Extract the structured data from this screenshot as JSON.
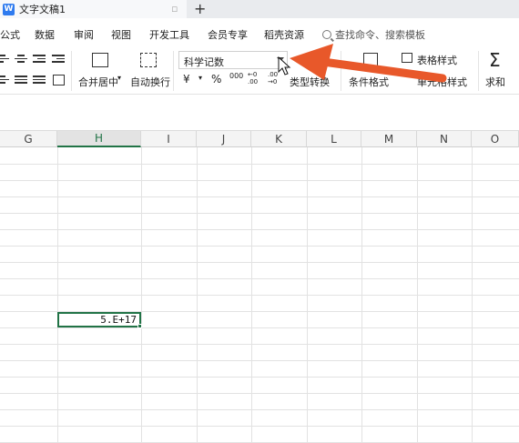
{
  "titlebar": {
    "doc_icon_letter": "W",
    "doc_title": "文字文稿1",
    "close_glyph": "▫",
    "new_tab_glyph": "+"
  },
  "menu": {
    "items": [
      "公式",
      "数据",
      "审阅",
      "视图",
      "开发工具",
      "会员专享",
      "稻壳资源"
    ],
    "search_placeholder": "查找命令、搜索模板"
  },
  "ribbon": {
    "merge_center": "合并居中",
    "auto_wrap": "自动换行",
    "number_format_value": "科学记数",
    "currency_symbol": "¥",
    "percent_symbol": "%",
    "thousands_symbol": "000",
    "dec_increase": "←0\n.00",
    "dec_decrease": ".00\n→0",
    "type_convert": "类型转换",
    "conditional_format": "条件格式",
    "table_style": "表格样式",
    "cell_style": "单元格样式",
    "sum_glyph": "Σ",
    "sum": "求和"
  },
  "grid": {
    "columns": [
      "G",
      "H",
      "I",
      "J",
      "K",
      "L",
      "M",
      "N",
      "O"
    ],
    "active_column": "H",
    "active_cell_value": "5.E+17"
  },
  "colors": {
    "accent_green": "#217346",
    "annotation_arrow": "#e8582a",
    "doc_icon_blue": "#2f7bef"
  }
}
